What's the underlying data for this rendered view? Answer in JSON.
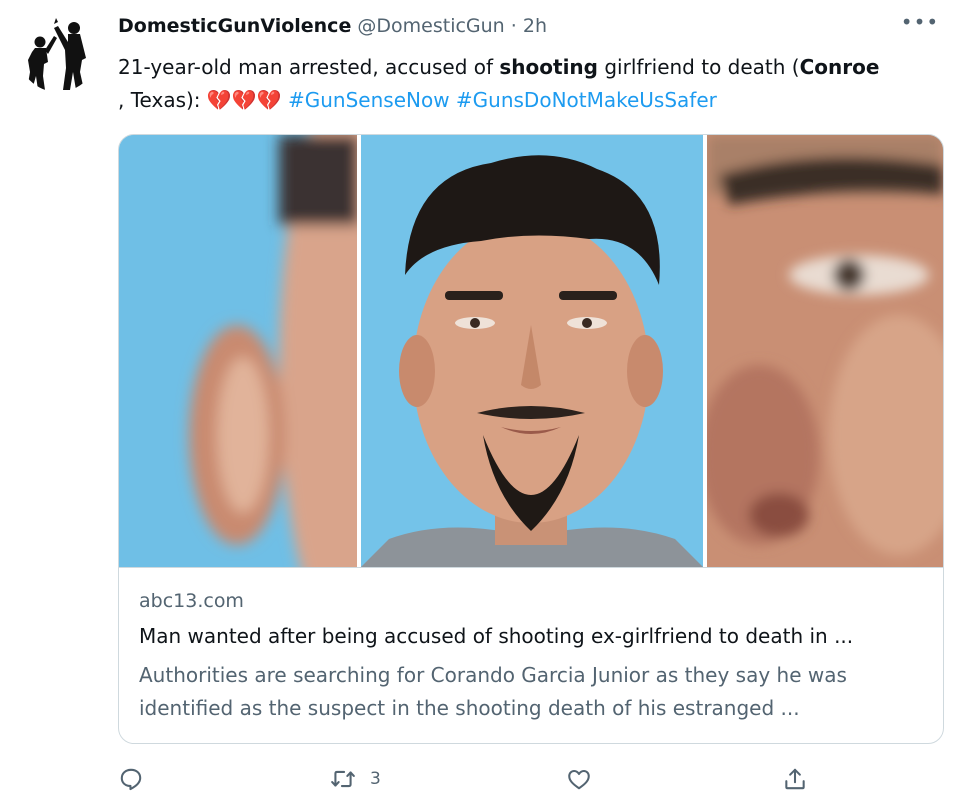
{
  "tweet": {
    "author_name": "DomesticGunViolence",
    "handle": "@DomesticGun",
    "separator": "·",
    "time": "2h",
    "more_label": "•••",
    "text_parts": [
      {
        "text": "21-year-old man arrested, accused of ",
        "bold": false
      },
      {
        "text": "shooting",
        "bold": true
      },
      {
        "text": " girlfriend to death (",
        "bold": false
      },
      {
        "text": "Conroe",
        "bold": true
      },
      {
        "text": ", Texas): ",
        "bold": false
      }
    ],
    "emojis": "💔💔💔",
    "hashtags": [
      "#GunSenseNow",
      "#GunsDoNotMakeUsSafer"
    ]
  },
  "card": {
    "domain": "abc13.com",
    "title": "Man wanted after being accused of shooting ex-girlfriend to death in ...",
    "description": "Authorities are searching for Corando Garcia Junior as they say he was identified as the suspect in the shooting death of his estranged ..."
  },
  "actions": {
    "reply_icon": "reply-icon",
    "retweet_icon": "retweet-icon",
    "retweet_count": "3",
    "like_icon": "heart-icon",
    "share_icon": "share-icon"
  },
  "colors": {
    "accent": "#1d9bf0",
    "secondary_text": "#536471",
    "border": "#cfd9de",
    "photo_background": "#74c3e9"
  }
}
